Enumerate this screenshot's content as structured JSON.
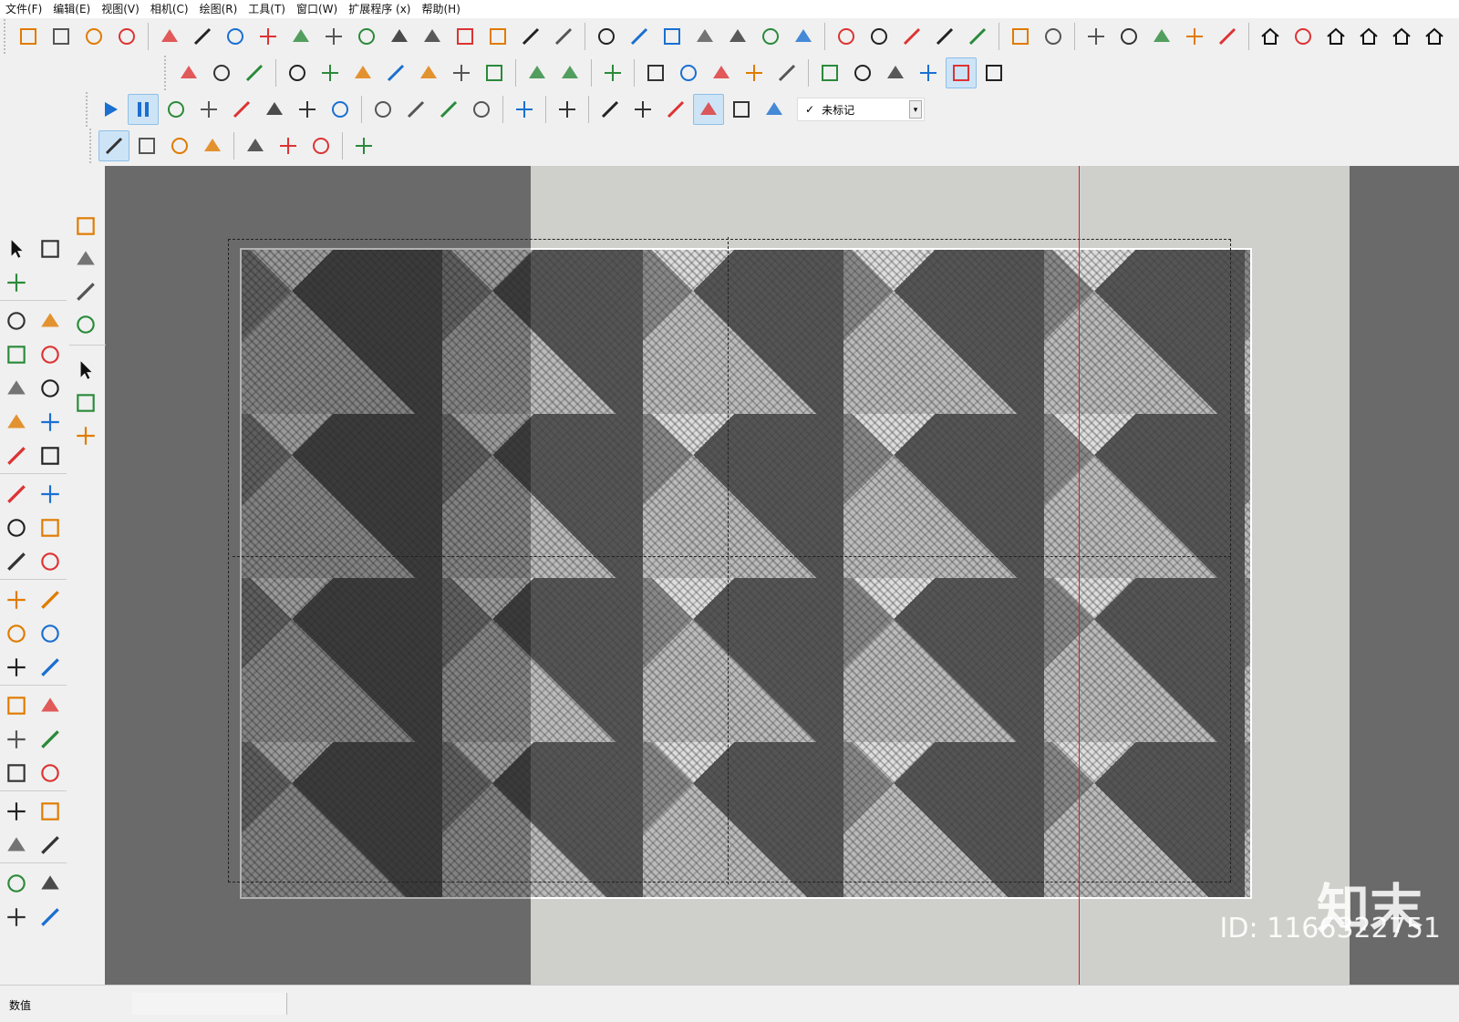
{
  "menu": [
    "文件(F)",
    "编辑(E)",
    "视图(V)",
    "相机(C)",
    "绘图(R)",
    "工具(T)",
    "窗口(W)",
    "扩展程序 (x)",
    "帮助(H)"
  ],
  "toolbar_rows": [
    {
      "icons": [
        "stairs-icon",
        "column-icon",
        "ramp-icon",
        "bar-steps-icon",
        "|",
        "flatten-icon",
        "line-align-icon",
        "curve-arrow-icon",
        "split-curve-icon",
        "bezier-icon",
        "loop-icon",
        "node-icon",
        "slab-icon",
        "weld-icon",
        "tiles-icon",
        "stack-icon",
        "box-cut-icon",
        "push-icon",
        "|",
        "arch-icon",
        "chain-icon",
        "wave-icon",
        "spiral-icon",
        "cut-wall-icon",
        "fence-icon",
        "pillars-icon",
        "|",
        "mirror-icon",
        "grid-dots-icon",
        "door-icon",
        "compass-icon",
        "brush-icon",
        "|",
        "plugin-a-icon",
        "plugin-b-icon",
        "|",
        "folder-export-icon",
        "checkbox-icon",
        "cloud-upload-icon",
        "cube-info-icon",
        "refresh-icon",
        "|",
        "house-3d-icon",
        "book-icon",
        "home-icon",
        "house-flat-icon",
        "house-outline-icon",
        "house-roof-icon"
      ]
    },
    {
      "icons": [
        "knife-icon",
        "dimension-icon",
        "follow-icon",
        "|",
        "plane-icon",
        "box-icon",
        "extrude-icon",
        "fold-icon",
        "wedge-icon",
        "cross-icon",
        "sweep-icon",
        "|",
        "scale-face-icon",
        "move-face-icon",
        "|",
        "group-a-icon",
        "|",
        "group-b-icon",
        "group-c-icon",
        "group-d-icon",
        "group-e-icon",
        "group-f-icon",
        "|",
        "face-a-icon",
        "face-b-icon",
        "face-c-icon",
        "face-d-icon",
        "layers-icon",
        "face-blue-icon"
      ]
    },
    {
      "icons": [
        "play-icon",
        "pause-icon",
        "record-icon",
        "stop-icon",
        "settings-icon",
        "film-icon",
        "film-delete-icon",
        "help-icon",
        "|",
        "point-icon",
        "cone-icon",
        "line-icon",
        "rectangle-icon",
        "|",
        "hide-icon",
        "|",
        "plugin-p-icon",
        "|",
        "orbit-icon",
        "camera-video-icon",
        "camera-icon",
        "timer-icon",
        "gear-dots-icon",
        "cube-down-icon"
      ],
      "tag": {
        "check": "✓",
        "value": "未标记"
      }
    },
    {
      "icons": [
        "cloud-link-icon",
        "cloud-network-icon",
        "cloud-check-icon",
        "cloud-list-icon",
        "|",
        "frame-icon",
        "flower-icon",
        "cycle-icon",
        "|",
        "chrome-icon"
      ]
    }
  ],
  "left_toolbar_1": [
    "select-icon",
    "component-icon",
    "eraser-icon",
    "|",
    "pencil-icon",
    "freehand-icon",
    "rectangle-icon",
    "rotated-rect-icon",
    "circle-icon",
    "polygon-icon",
    "arc-icon",
    "arc-2pt-icon",
    "arc-3pt-icon",
    "pie-icon",
    "|",
    "move-icon",
    "push-pull-icon",
    "rotate-icon",
    "follow-me-icon",
    "scale-icon",
    "offset-icon",
    "|",
    "tape-measure-icon",
    "text-icon",
    "protractor-icon",
    "3d-text-icon",
    "axes-icon",
    "paint-bucket-icon",
    "|",
    "orbit-icon",
    "pan-icon",
    "zoom-icon",
    "zoom-window-icon",
    "zoom-extents-icon",
    "previous-view-icon",
    "|",
    "position-camera-icon",
    "look-around-icon",
    "walk-icon",
    "section-plane-icon",
    "|",
    "sandbox-a-icon",
    "sandbox-b-icon",
    "sandbox-c-icon",
    "sandbox-d-icon"
  ],
  "left_toolbar_2": [
    "import-icon",
    "export-icon",
    "paint-icon",
    "gears-icon",
    "|",
    "select-icon",
    "component-icon",
    "eraser-icon"
  ],
  "status": {
    "label": "数值"
  },
  "watermark": {
    "brand": "知末",
    "id": "ID: 1166322751"
  },
  "colors": {
    "viewport_dark": "#6a6a6a",
    "viewport_light": "#cfcfcb",
    "axis_red": "#dd2222",
    "accent_blue": "#1a6fd1"
  }
}
